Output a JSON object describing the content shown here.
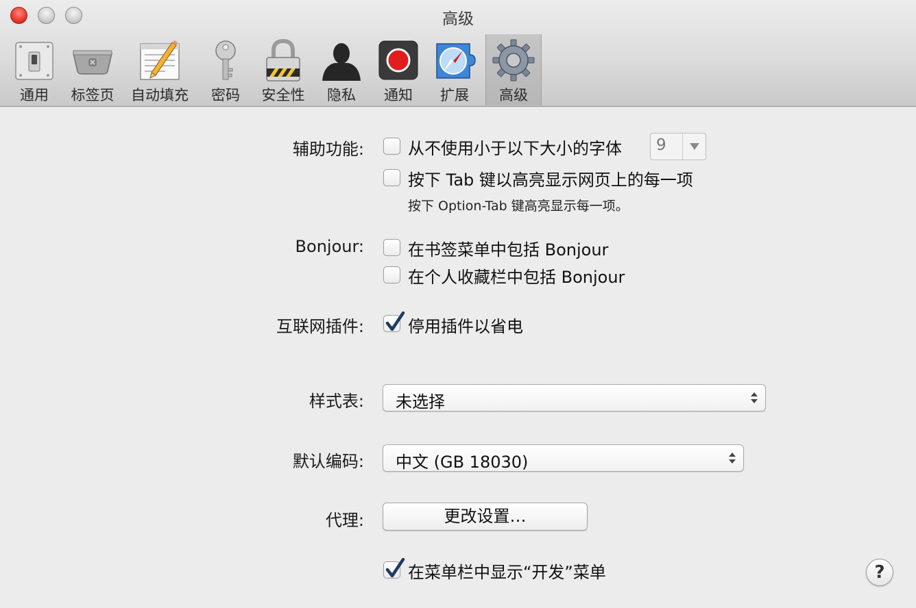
{
  "window": {
    "title": "高级"
  },
  "toolbar": {
    "items": [
      {
        "label": "通用",
        "icon": "switch-icon"
      },
      {
        "label": "标签页",
        "icon": "tabs-icon"
      },
      {
        "label": "自动填充",
        "icon": "autofill-icon"
      },
      {
        "label": "密码",
        "icon": "key-icon"
      },
      {
        "label": "安全性",
        "icon": "lock-icon"
      },
      {
        "label": "隐私",
        "icon": "person-silhouette-icon"
      },
      {
        "label": "通知",
        "icon": "notification-record-icon"
      },
      {
        "label": "扩展",
        "icon": "extensions-compass-icon"
      },
      {
        "label": "高级",
        "icon": "gear-icon"
      }
    ],
    "selected": "高级"
  },
  "accessibility": {
    "label": "辅助功能:",
    "min_font": {
      "label": "从不使用小于以下大小的字体",
      "checked": false,
      "size_value": "9"
    },
    "tab_highlight": {
      "label": "按下 Tab 键以高亮显示网页上的每一项",
      "checked": false
    },
    "note": "按下 Option-Tab 键高亮显示每一项。"
  },
  "bonjour": {
    "label": "Bonjour:",
    "bookmarks_menu": {
      "label": "在书签菜单中包括 Bonjour",
      "checked": false
    },
    "favorites_bar": {
      "label": "在个人收藏栏中包括 Bonjour",
      "checked": false
    }
  },
  "plugins": {
    "label": "互联网插件:",
    "stop_plugins": {
      "label": "停用插件以省电",
      "checked": true
    }
  },
  "stylesheet": {
    "label": "样式表:",
    "value": "未选择"
  },
  "encoding": {
    "label": "默认编码:",
    "value": "中文 (GB 18030)"
  },
  "proxy": {
    "label": "代理:",
    "button_label": "更改设置…"
  },
  "develop_menu": {
    "label": "在菜单栏中显示“开发”菜单",
    "checked": true
  },
  "help": {
    "label": "?"
  },
  "colors": {
    "window_bg": "#ececec",
    "checkmark": "#1f3a63",
    "close_button": "#f03b2f"
  }
}
